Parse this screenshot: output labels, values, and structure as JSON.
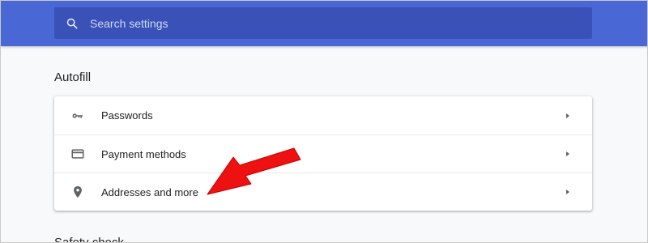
{
  "search": {
    "placeholder": "Search settings",
    "icon": "search-icon"
  },
  "autofill": {
    "title": "Autofill",
    "items": [
      {
        "label": "Passwords",
        "icon": "key-icon"
      },
      {
        "label": "Payment methods",
        "icon": "credit-card-icon"
      },
      {
        "label": "Addresses and more",
        "icon": "location-pin-icon"
      }
    ]
  },
  "next_section": {
    "title": "Safety check"
  },
  "colors": {
    "header": "#4a67d6",
    "search_bg": "#3a52b8",
    "annotation_arrow": "#ee1111"
  }
}
